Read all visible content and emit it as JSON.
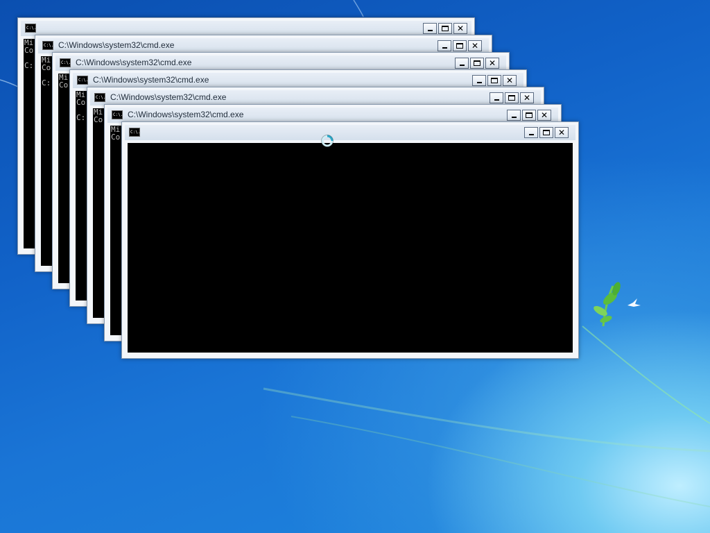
{
  "desktop": {
    "background": "#1a6fd4",
    "accent": "#6fcaf2"
  },
  "windows": [
    {
      "title": "",
      "console_lines": [
        "Mi",
        "Co",
        "",
        "C:"
      ]
    },
    {
      "title": "C:\\Windows\\system32\\cmd.exe",
      "console_lines": [
        "Mi",
        "Co",
        "",
        "C:"
      ]
    },
    {
      "title": "C:\\Windows\\system32\\cmd.exe",
      "console_lines": [
        "Mi",
        "Co"
      ]
    },
    {
      "title": "C:\\Windows\\system32\\cmd.exe",
      "console_lines": [
        "Mi",
        "Co",
        "",
        "C:"
      ]
    },
    {
      "title": "C:\\Windows\\system32\\cmd.exe",
      "console_lines": [
        "Mi",
        "Co"
      ]
    },
    {
      "title": "C:\\Windows\\system32\\cmd.exe",
      "console_lines": [
        "Mi",
        "Co"
      ]
    },
    {
      "title": "",
      "console_lines": []
    }
  ],
  "icons": {
    "system_icon": "cmd-icon",
    "system_icon_text": "C:\\.",
    "minimize": "minimize-icon",
    "maximize": "maximize-icon",
    "close": "close-icon",
    "close_glyph": "✕",
    "busy": "busy-cursor-icon"
  }
}
